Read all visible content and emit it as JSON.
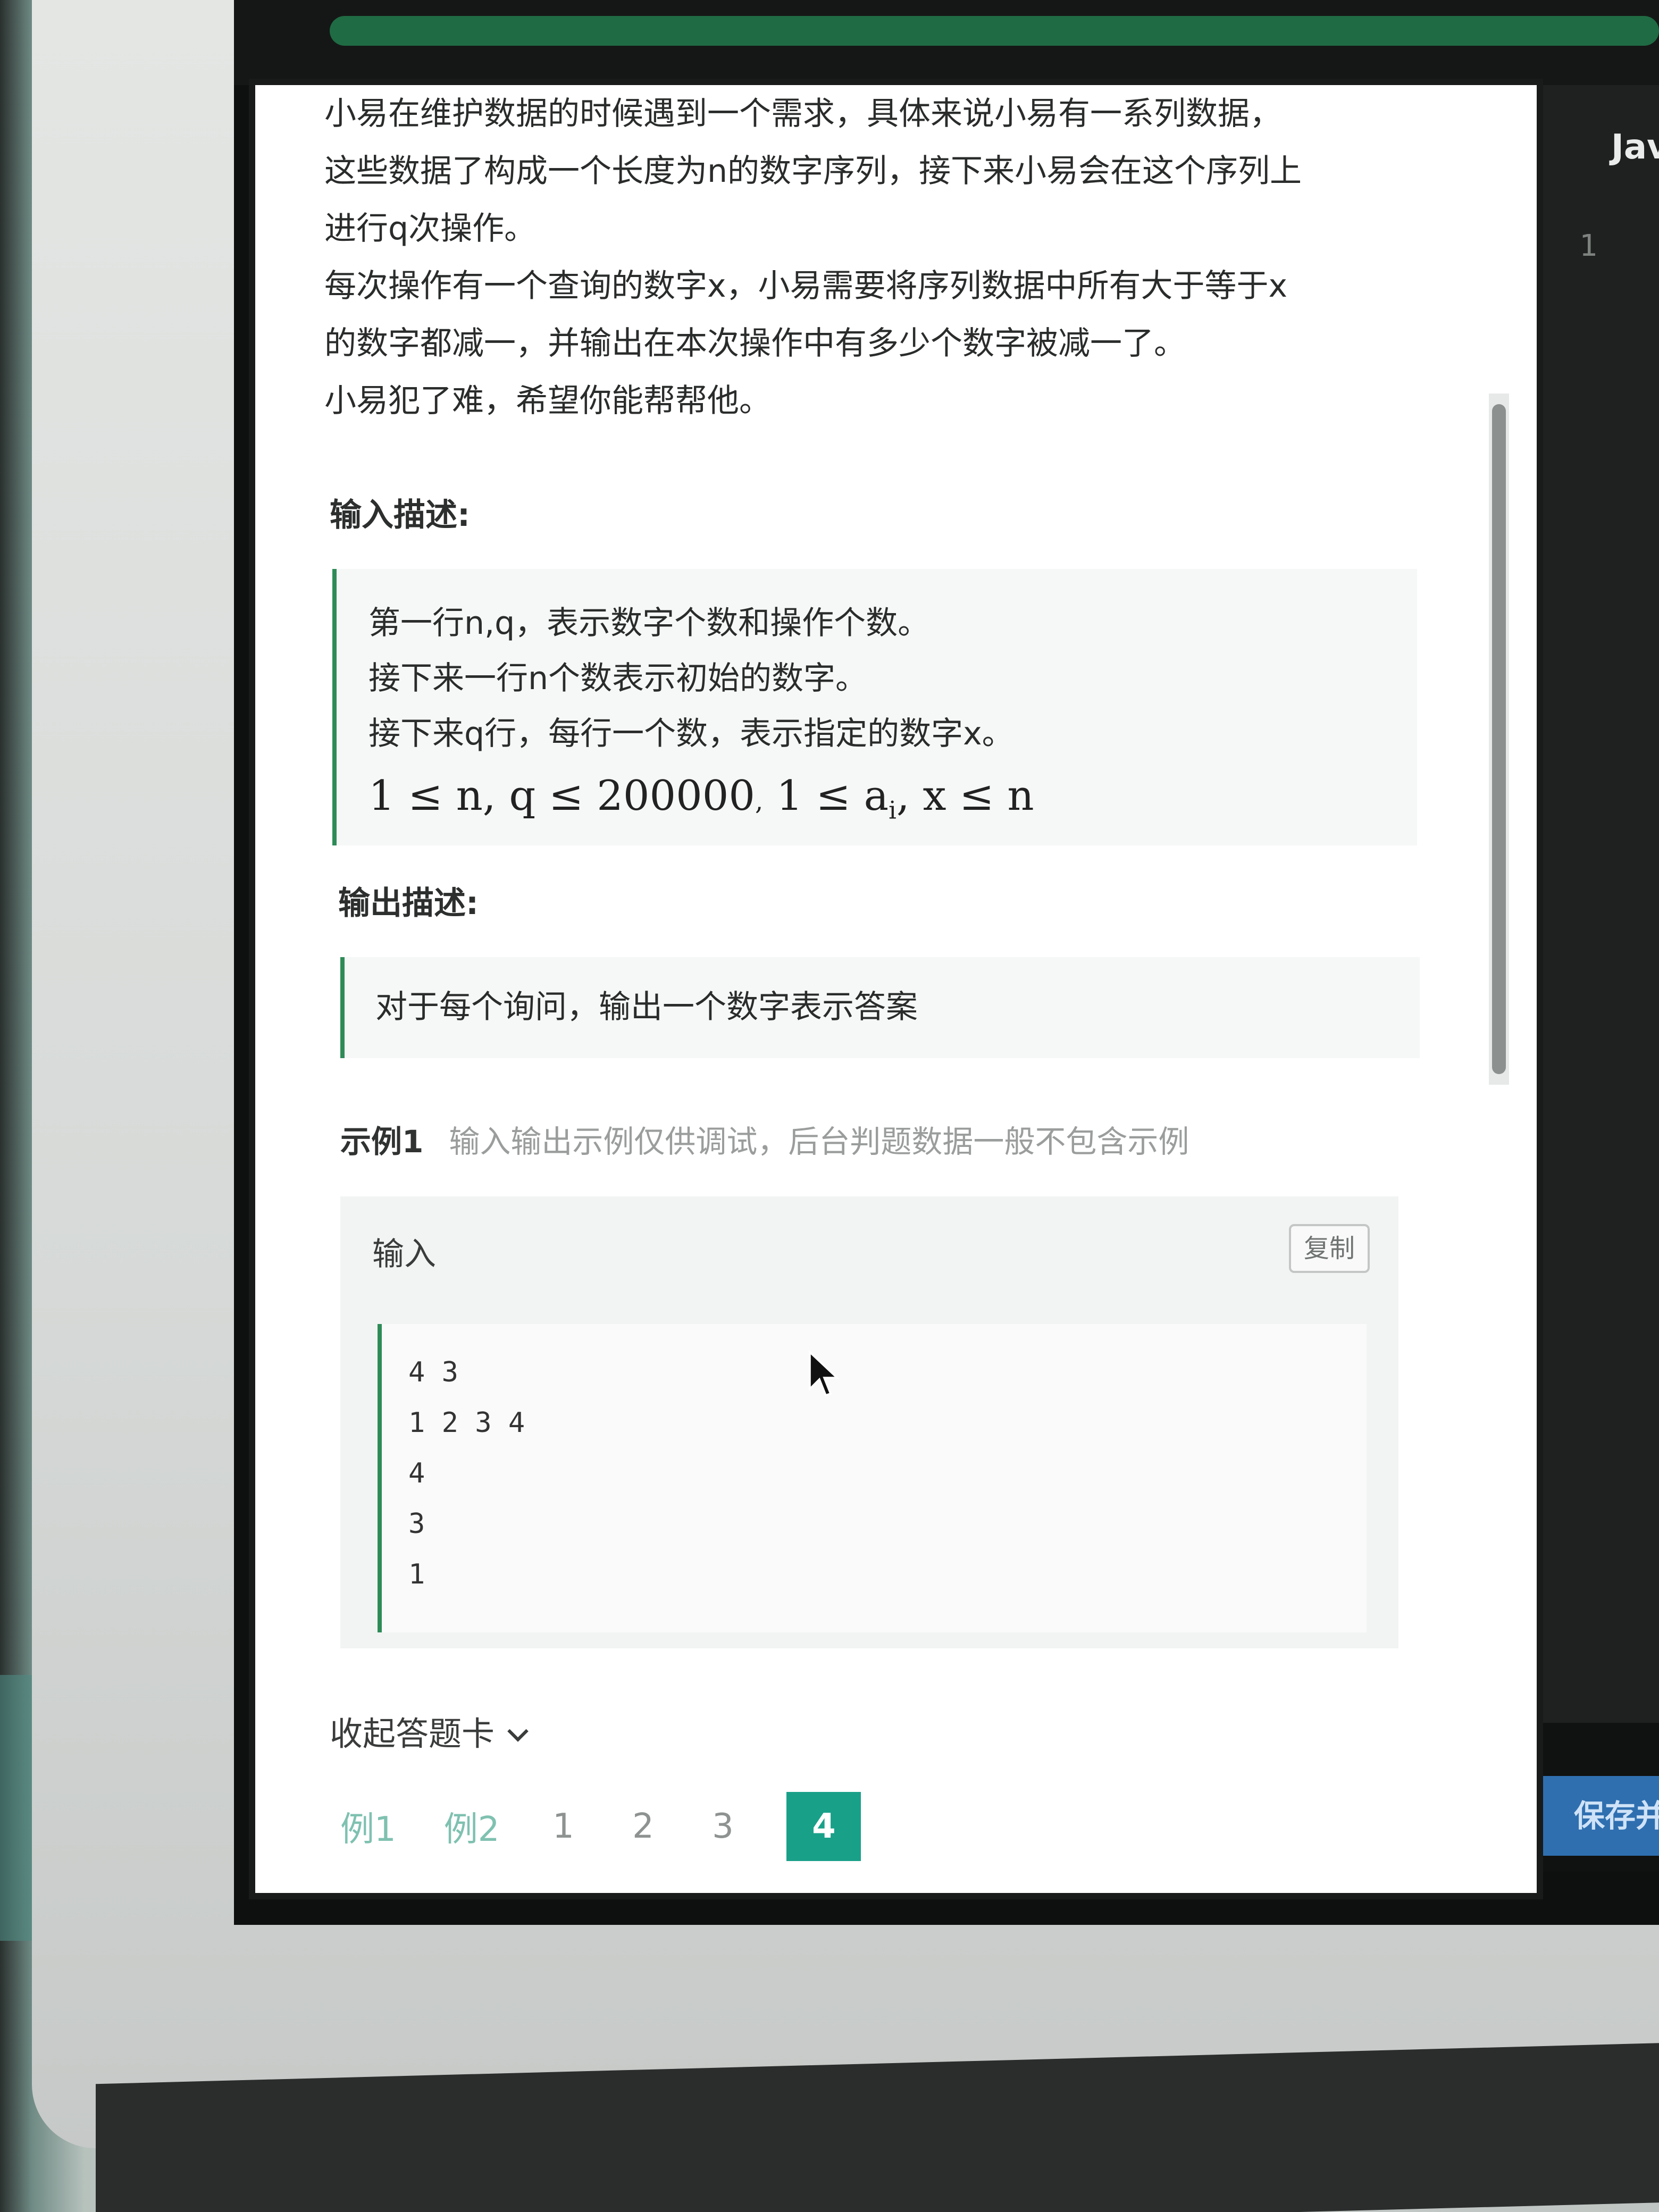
{
  "editor": {
    "language_label": "Jav",
    "line_number": "1",
    "save_button": "保存并"
  },
  "problem": {
    "description": [
      "小易在维护数据的时候遇到一个需求，具体来说小易有一系列数据，",
      "这些数据了构成一个长度为n的数字序列，接下来小易会在这个序列上",
      "进行q次操作。",
      "每次操作有一个查询的数字x，小易需要将序列数据中所有大于等于x",
      "的数字都减一，并输出在本次操作中有多少个数字被减一了。",
      "小易犯了难，希望你能帮帮他。"
    ],
    "input_label": "输入描述:",
    "input_lines": [
      "第一行n,q，表示数字个数和操作个数。",
      "接下来一行n个数表示初始的数字。",
      "接下来q行，每行一个数，表示指定的数字x。"
    ],
    "constraint_a": "1 ≤ n, q ≤ 200000",
    "constraint_sep": ",",
    "constraint_b": "1 ≤ a",
    "constraint_b_sub": "i",
    "constraint_c": ", x ≤ n",
    "output_label": "输出描述:",
    "output_line": "对于每个询问，输出一个数字表示答案"
  },
  "example": {
    "title": "示例1",
    "hint": "输入输出示例仅供调试，后台判题数据一般不包含示例",
    "input_label": "输入",
    "copy_label": "复制",
    "input_lines": [
      "4 3",
      "1 2 3 4",
      "4",
      "3",
      "1"
    ]
  },
  "answer_card": {
    "collapse_label": "收起答题卡",
    "items": [
      "例1",
      "例2",
      "1",
      "2",
      "3",
      "4"
    ],
    "active": "4"
  }
}
